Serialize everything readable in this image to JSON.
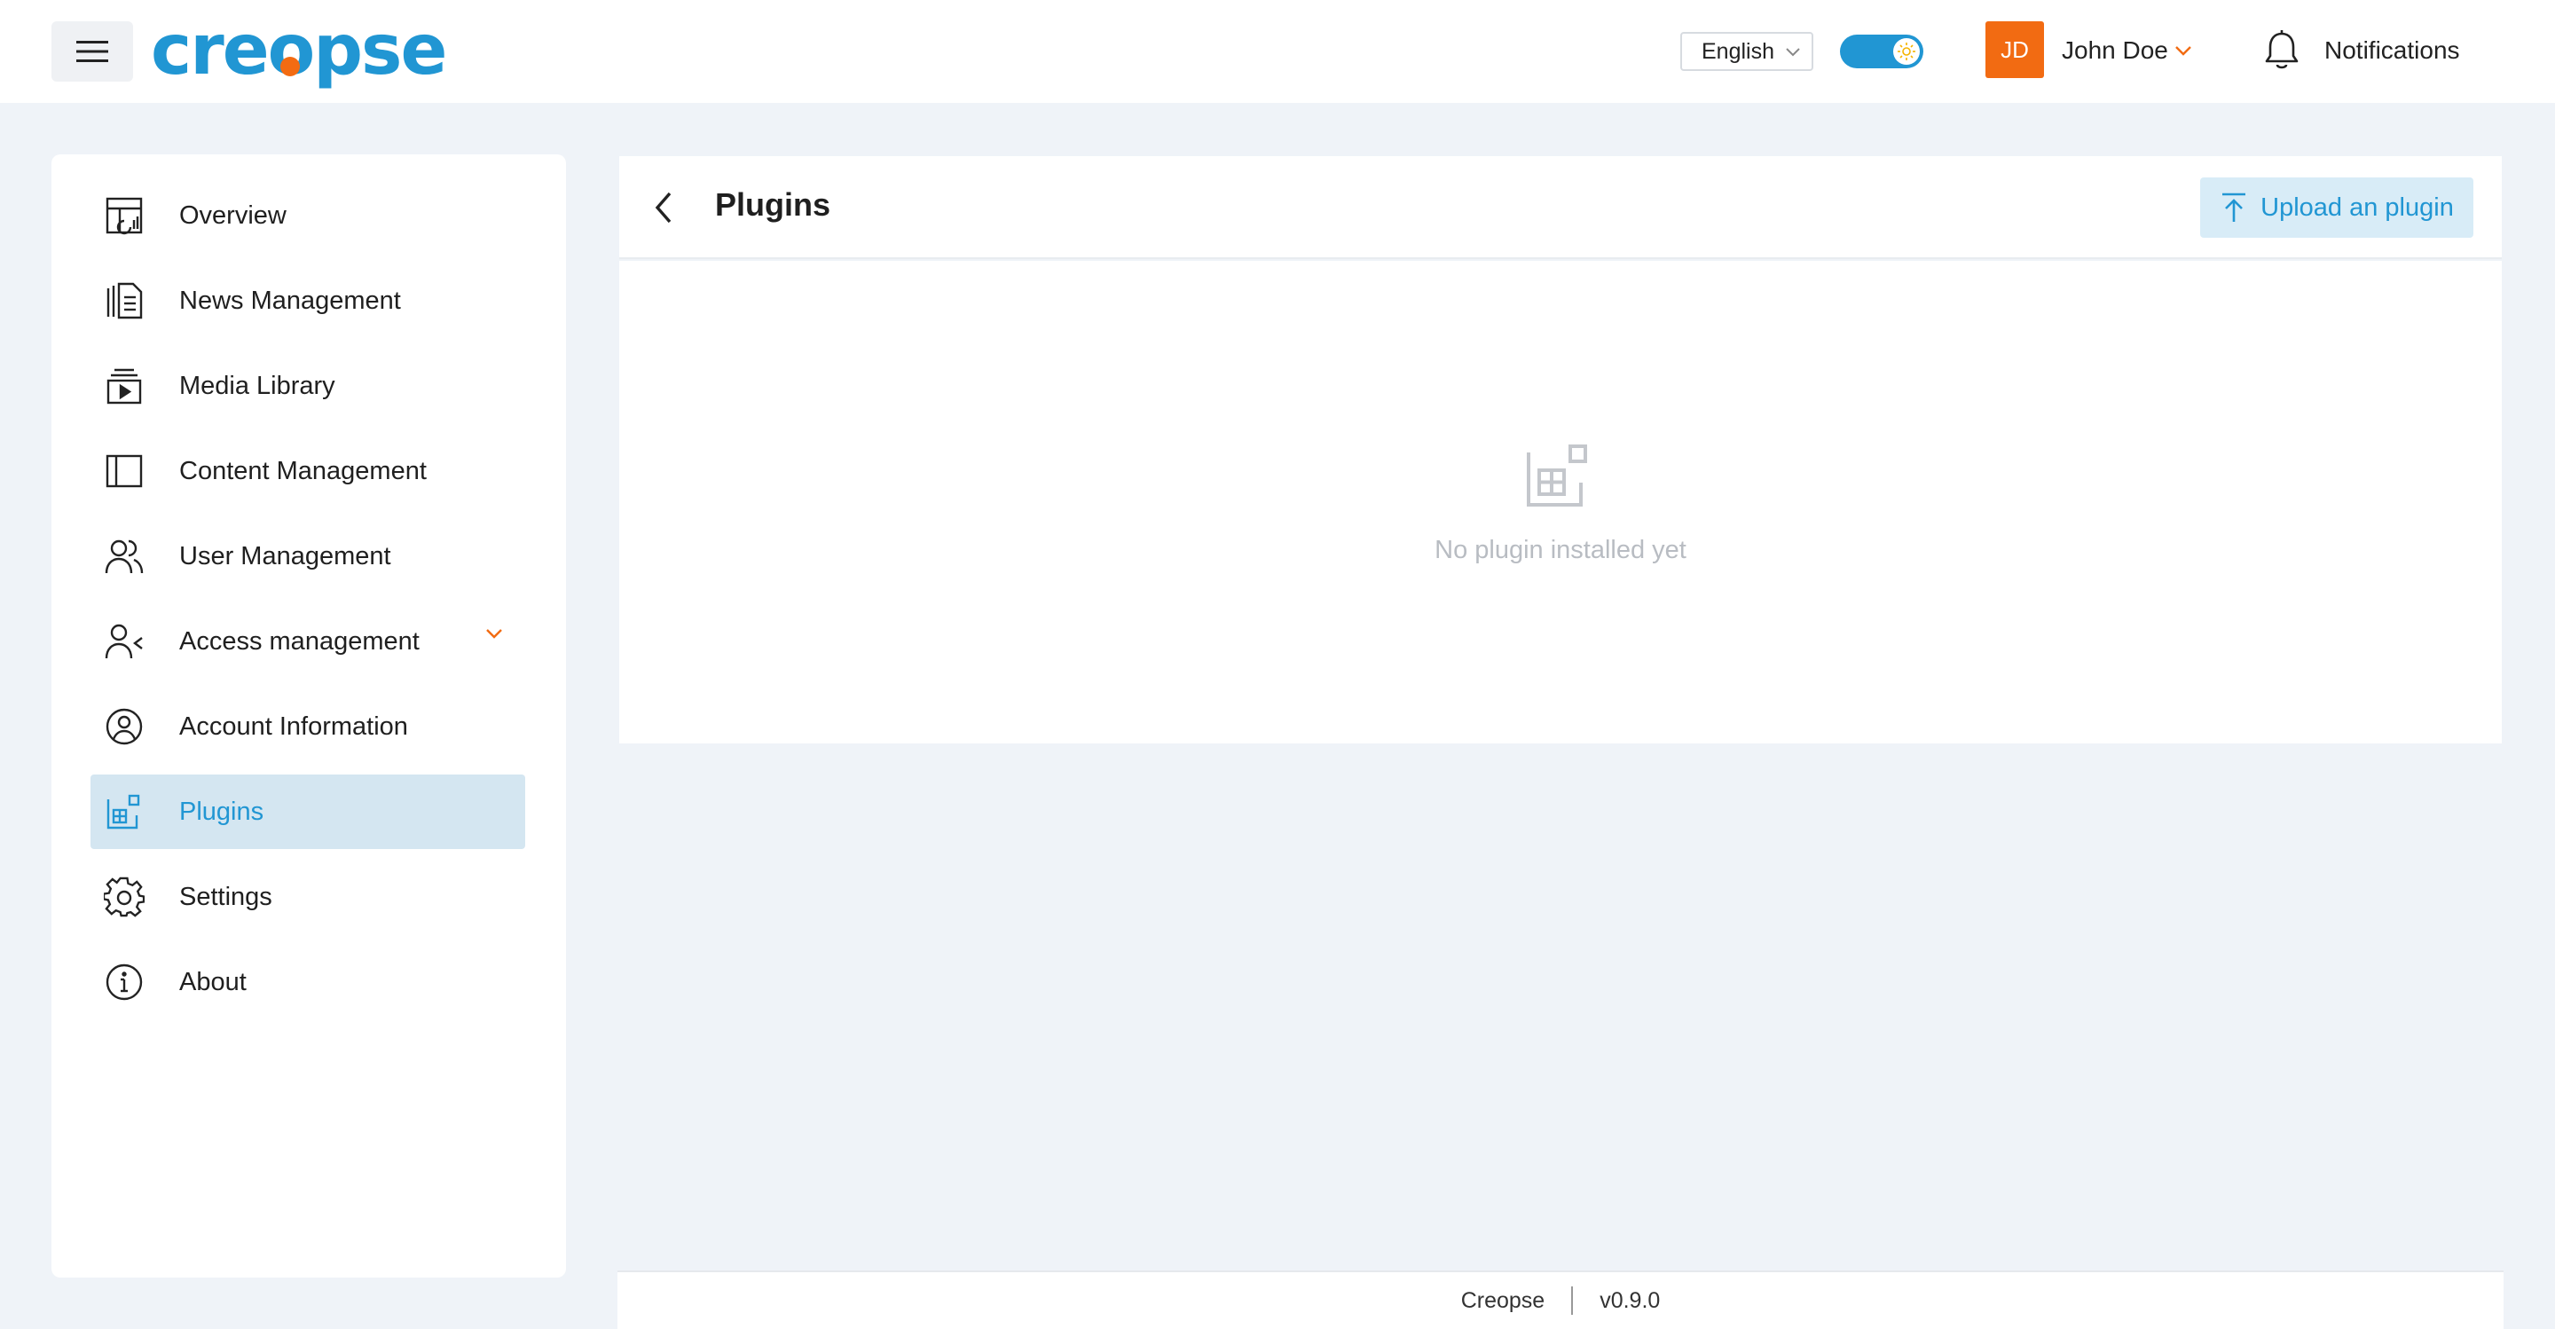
{
  "header": {
    "menu_icon": "hamburger-icon",
    "logo_text_a": "cre",
    "logo_text_o": "o",
    "logo_text_b": "pse",
    "language": {
      "selected": "English"
    },
    "theme_toggle": {
      "on": true,
      "icon": "sun-icon"
    },
    "user": {
      "initials": "JD",
      "name": "John Doe"
    },
    "notifications_label": "Notifications"
  },
  "sidebar": {
    "items": [
      {
        "label": "Overview",
        "icon": "overview-icon"
      },
      {
        "label": "News Management",
        "icon": "news-icon"
      },
      {
        "label": "Media Library",
        "icon": "media-library-icon"
      },
      {
        "label": "Content Management",
        "icon": "content-icon"
      },
      {
        "label": "User Management",
        "icon": "users-icon"
      },
      {
        "label": "Access management",
        "icon": "access-icon",
        "expandable": true
      },
      {
        "label": "Account Information",
        "icon": "account-icon"
      },
      {
        "label": "Plugins",
        "icon": "plugins-icon",
        "active": true
      },
      {
        "label": "Settings",
        "icon": "gear-icon"
      },
      {
        "label": "About",
        "icon": "info-icon"
      }
    ]
  },
  "main": {
    "title": "Plugins",
    "upload_label": "Upload an plugin",
    "empty_text": "No plugin installed yet"
  },
  "footer": {
    "app_name": "Creopse",
    "version": "v0.9.0"
  },
  "colors": {
    "accent": "#2196d3",
    "brand_orange": "#f26b12",
    "page_bg": "#eff3f8",
    "active_bg": "#d4e6f1"
  }
}
